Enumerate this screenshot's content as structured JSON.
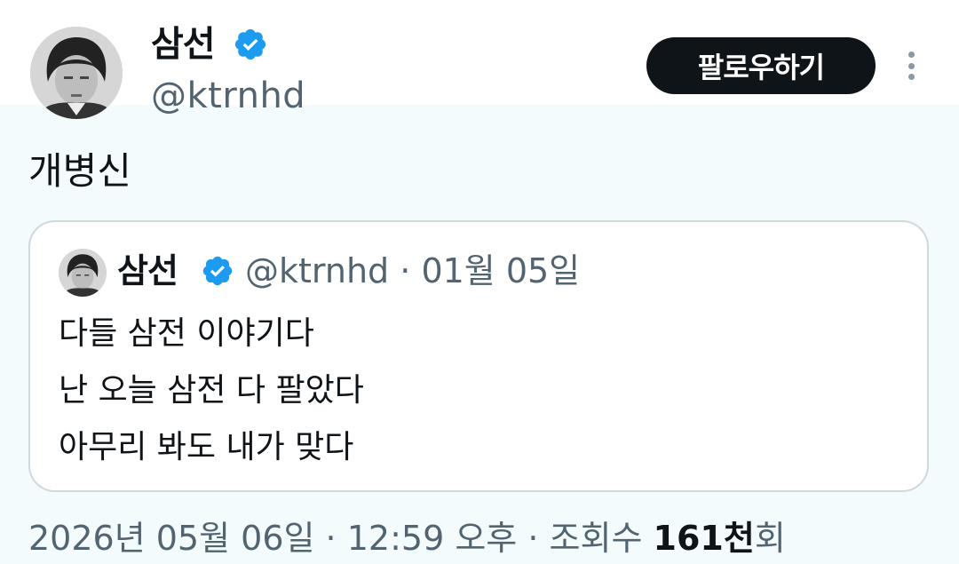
{
  "author": {
    "display_name": "삼선",
    "handle": "@ktrnhd",
    "verified": true,
    "verified_icon": "verified-badge-icon"
  },
  "actions": {
    "follow_label": "팔로우하기",
    "more_icon": "more-options-icon"
  },
  "tweet": {
    "text": "개병신"
  },
  "quoted_tweet": {
    "display_name": "삼선",
    "handle": "@ktrnhd",
    "separator": "·",
    "date": "01월 05일",
    "lines": [
      "다들 삼전 이야기다",
      "난 오늘 삼전 다 팔았다",
      "아무리 봐도 내가 맞다"
    ]
  },
  "footer": {
    "date": "2026년 05월 06일",
    "separator": "·",
    "time": "12:59 오후",
    "views_prefix": "조회수",
    "views_value": "161천",
    "views_suffix": "회"
  },
  "colors": {
    "verified": "#1d9bf0",
    "follow_bg": "#0f1419",
    "secondary_text": "#536471"
  }
}
